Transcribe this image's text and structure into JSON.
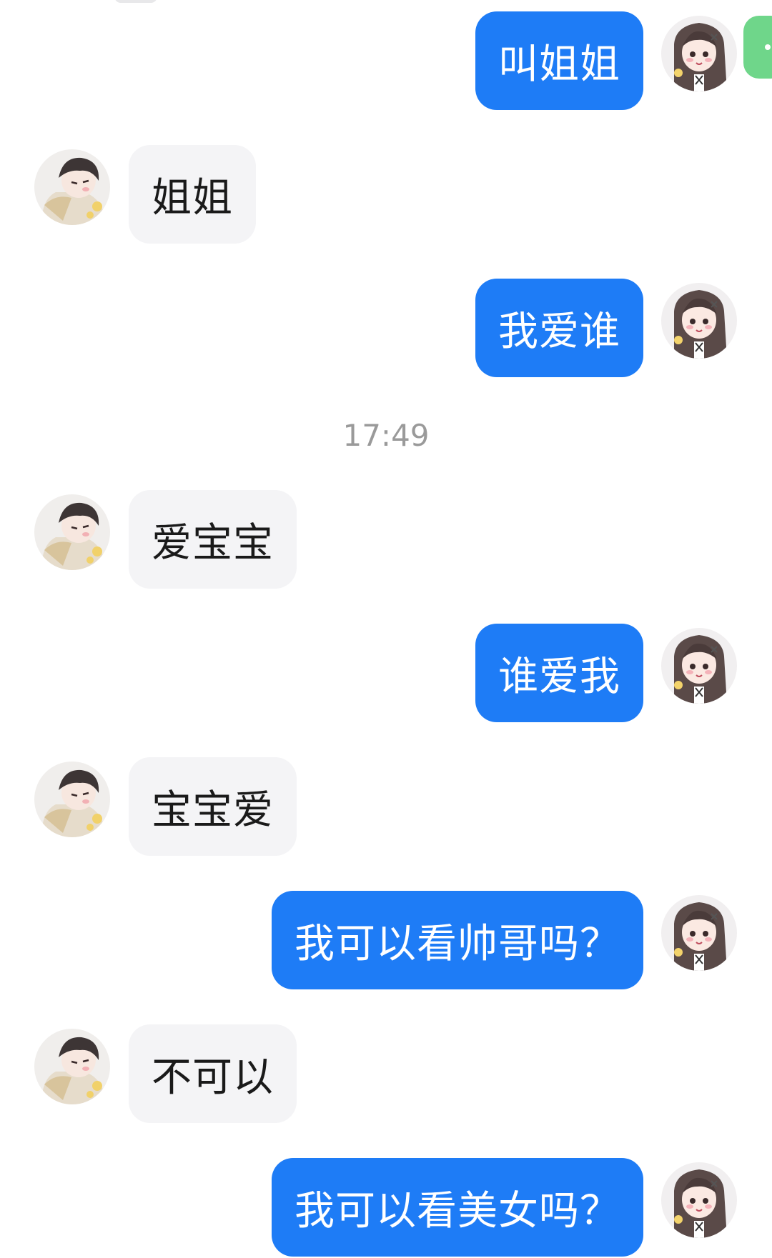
{
  "chat": {
    "messages": [
      {
        "side": "out",
        "text": "叫姐姐"
      },
      {
        "side": "in",
        "text": "姐姐"
      },
      {
        "side": "out",
        "text": "我爱谁"
      },
      {
        "side": "in",
        "text": "爱宝宝"
      },
      {
        "side": "out",
        "text": "谁爱我"
      },
      {
        "side": "in",
        "text": "宝宝爱"
      },
      {
        "side": "out",
        "text": "我可以看帅哥吗？"
      },
      {
        "side": "in",
        "text": "不可以"
      },
      {
        "side": "out",
        "text": "我可以看美女吗？"
      }
    ],
    "timestamp": "17:49"
  },
  "avatars": {
    "incoming": "avatar-boy-anime",
    "outgoing": "avatar-girl-anime"
  },
  "colors": {
    "outgoing_bubble": "#1e7cf6",
    "incoming_bubble": "#f4f4f6",
    "timestamp": "#9a9a9a",
    "edge_button": "#6fd68a"
  }
}
